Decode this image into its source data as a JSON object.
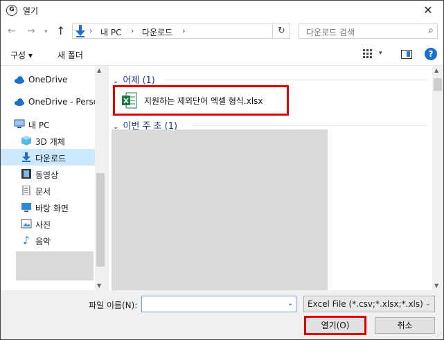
{
  "window": {
    "title": "열기"
  },
  "nav": {
    "breadcrumb": [
      "내 PC",
      "다운로드"
    ],
    "search_placeholder": "다운로드 검색"
  },
  "toolbar": {
    "organize_label": "구성 ▾",
    "new_folder_label": "새 폴더"
  },
  "sidebar": {
    "items": [
      {
        "label": "OneDrive",
        "icon": "cloud-icon"
      },
      {
        "label": "OneDrive - Person",
        "icon": "cloud-icon"
      },
      {
        "label": "내 PC",
        "icon": "computer-icon"
      },
      {
        "label": "3D 개체",
        "icon": "cube-icon"
      },
      {
        "label": "다운로드",
        "icon": "download-icon",
        "selected": true
      },
      {
        "label": "동영상",
        "icon": "film-icon"
      },
      {
        "label": "문서",
        "icon": "document-icon"
      },
      {
        "label": "바탕 화면",
        "icon": "desktop-icon"
      },
      {
        "label": "사진",
        "icon": "picture-icon"
      },
      {
        "label": "음악",
        "icon": "music-icon"
      }
    ]
  },
  "files": {
    "groups": [
      {
        "header": "어제 (1)",
        "items": [
          {
            "name": "지원하는 제외단어 엑셀 형식.xlsx",
            "icon": "excel-icon"
          }
        ]
      },
      {
        "header": "이번 주 초 (1)",
        "items": []
      }
    ]
  },
  "bottom": {
    "filename_label": "파일 이름(N):",
    "filename_value": "",
    "filetype_value": "Excel File  (*.csv;*.xlsx;*.xls)",
    "open_label": "열기(O)",
    "cancel_label": "취소"
  },
  "colors": {
    "highlight": "#e00000",
    "selection": "#cce8ff",
    "accent": "#1f6fd1",
    "excel": "#1d7a45"
  }
}
